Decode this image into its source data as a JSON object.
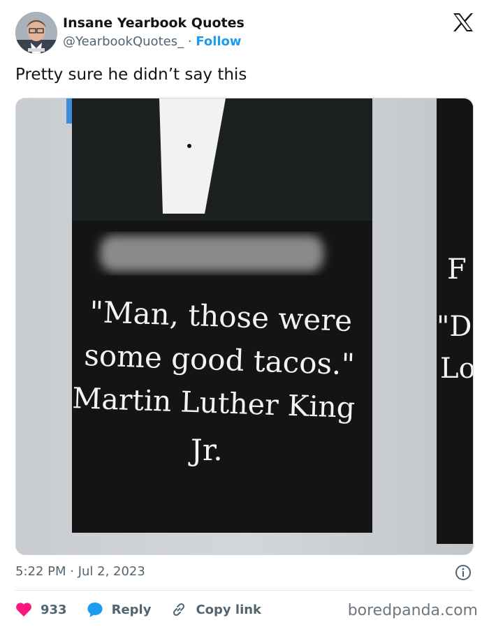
{
  "author": {
    "name": "Insane Yearbook Quotes",
    "handle": "@YearbookQuotes_",
    "separator": " · ",
    "follow_label": "Follow",
    "avatar_icon": "profile-photo"
  },
  "tweet": {
    "text": "Pretty sure he didn’t say this",
    "timestamp": "5:22 PM · Jul 2, 2023"
  },
  "media": {
    "quote_lines": [
      "\"Man, those were",
      "some good tacos.\"",
      "Martin Luther King",
      "Jr."
    ],
    "side_letters": [
      "F",
      "\"D",
      "Lo"
    ]
  },
  "actions": {
    "likes": "933",
    "reply_label": "Reply",
    "copy_label": "Copy link"
  },
  "watermark": "boredpanda.com",
  "colors": {
    "accent": "#1d9bf0",
    "like": "#f91880",
    "text_secondary": "#536471"
  },
  "icons": {
    "platform": "x-logo-icon",
    "info": "info-icon",
    "like": "heart-icon",
    "reply": "speech-bubble-icon",
    "copy": "link-icon"
  }
}
